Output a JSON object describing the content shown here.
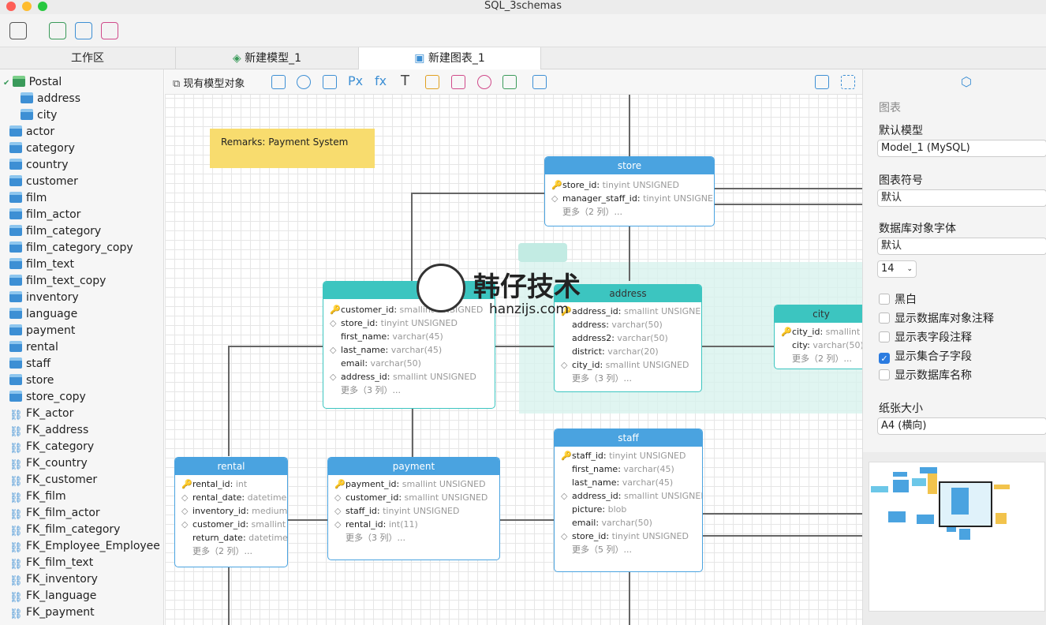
{
  "window": {
    "title": "SQL_3schemas"
  },
  "tabs": {
    "workspace": "工作区",
    "model_tab": "新建模型_1",
    "diagram_tab": "新建图表_1"
  },
  "sidebar": {
    "schema": "Postal",
    "children": [
      "address",
      "city"
    ],
    "tables": [
      "actor",
      "category",
      "country",
      "customer",
      "film",
      "film_actor",
      "film_category",
      "film_category_copy",
      "film_text",
      "film_text_copy",
      "inventory",
      "language",
      "payment",
      "rental",
      "staff",
      "store",
      "store_copy"
    ],
    "links": [
      "FK_actor",
      "FK_address",
      "FK_category",
      "FK_country",
      "FK_customer",
      "FK_film",
      "FK_film_actor",
      "FK_film_category",
      "FK_Employee_Employee",
      "FK_film_text",
      "FK_inventory",
      "FK_language",
      "FK_payment"
    ]
  },
  "canvas_toolbar": {
    "existing_objects": "现有模型对象"
  },
  "note": "Remarks: Payment System",
  "entities": {
    "store": {
      "title": "store",
      "rows": [
        [
          "key",
          "store_id:",
          "tinyint UNSIGNED"
        ],
        [
          "diamond",
          "manager_staff_id:",
          "tinyint UNSIGNED"
        ]
      ],
      "more": "更多（2 列）..."
    },
    "customer": {
      "rows": [
        [
          "key",
          "customer_id:",
          "smallint UNSIGNED"
        ],
        [
          "diamond",
          "store_id:",
          "tinyint UNSIGNED"
        ],
        [
          "none",
          "first_name:",
          "varchar(45)"
        ],
        [
          "diamond",
          "last_name:",
          "varchar(45)"
        ],
        [
          "none",
          "email:",
          "varchar(50)"
        ],
        [
          "diamond",
          "address_id:",
          "smallint UNSIGNED"
        ]
      ],
      "more": "更多（3 列）..."
    },
    "address": {
      "title": "address",
      "rows": [
        [
          "key",
          "address_id:",
          "smallint UNSIGNED"
        ],
        [
          "none",
          "address:",
          "varchar(50)"
        ],
        [
          "none",
          "address2:",
          "varchar(50)"
        ],
        [
          "none",
          "district:",
          "varchar(20)"
        ],
        [
          "diamond",
          "city_id:",
          "smallint UNSIGNED"
        ]
      ],
      "more": "更多（3 列）..."
    },
    "city": {
      "title": "city",
      "rows": [
        [
          "key",
          "city_id:",
          "smallint"
        ],
        [
          "none",
          "city:",
          "varchar(50)"
        ]
      ],
      "more": "更多（2 列）..."
    },
    "rental": {
      "title": "rental",
      "rows": [
        [
          "key",
          "rental_id:",
          "int"
        ],
        [
          "diamond",
          "rental_date:",
          "datetime"
        ],
        [
          "diamond",
          "inventory_id:",
          "mediumint"
        ],
        [
          "diamond",
          "customer_id:",
          "smallint"
        ],
        [
          "none",
          "return_date:",
          "datetime"
        ]
      ],
      "more": "更多（2 列）..."
    },
    "payment": {
      "title": "payment",
      "rows": [
        [
          "key",
          "payment_id:",
          "smallint UNSIGNED"
        ],
        [
          "diamond",
          "customer_id:",
          "smallint UNSIGNED"
        ],
        [
          "diamond",
          "staff_id:",
          "tinyint UNSIGNED"
        ],
        [
          "diamond",
          "rental_id:",
          "int(11)"
        ]
      ],
      "more": "更多（3 列）..."
    },
    "staff": {
      "title": "staff",
      "rows": [
        [
          "key",
          "staff_id:",
          "tinyint UNSIGNED"
        ],
        [
          "none",
          "first_name:",
          "varchar(45)"
        ],
        [
          "none",
          "last_name:",
          "varchar(45)"
        ],
        [
          "diamond",
          "address_id:",
          "smallint UNSIGNED"
        ],
        [
          "none",
          "picture:",
          "blob"
        ],
        [
          "none",
          "email:",
          "varchar(50)"
        ],
        [
          "diamond",
          "store_id:",
          "tinyint UNSIGNED"
        ]
      ],
      "more": "更多（5 列）..."
    }
  },
  "right_panel": {
    "section": "图表",
    "default_model_label": "默认模型",
    "default_model_value": "Model_1 (MySQL)",
    "notation_label": "图表符号",
    "notation_value": "默认",
    "font_label": "数据库对象字体",
    "font_value": "默认",
    "font_size": "14",
    "options": [
      {
        "label": "黑白",
        "checked": false
      },
      {
        "label": "显示数据库对象注释",
        "checked": false
      },
      {
        "label": "显示表字段注释",
        "checked": false
      },
      {
        "label": "显示集合子字段",
        "checked": true
      },
      {
        "label": "显示数据库名称",
        "checked": false
      }
    ],
    "paper_label": "纸张大小",
    "paper_value": "A4 (横向)"
  },
  "watermark": {
    "text": "韩仔技术",
    "url": "hanzijs.com"
  },
  "colors": {
    "entity_blue": "#4aa3e0",
    "entity_teal": "#3cc5c0",
    "note": "#f8dc6e"
  }
}
